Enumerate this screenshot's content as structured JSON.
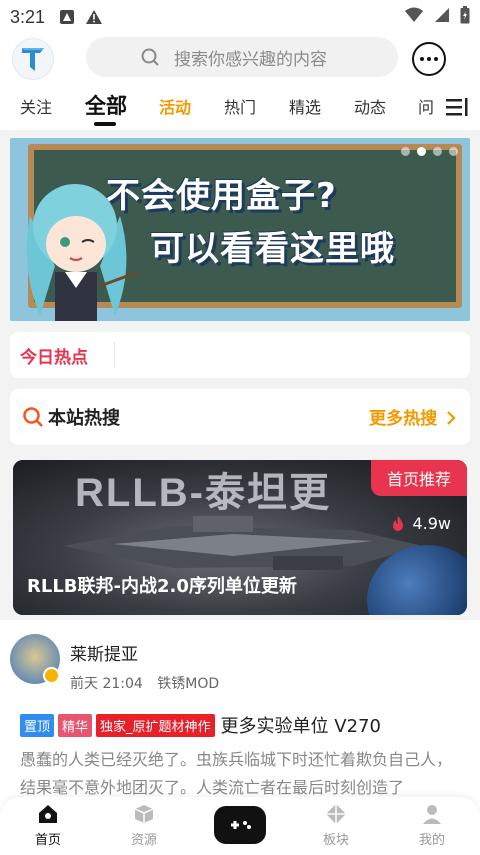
{
  "status_bar": {
    "time": "3:21"
  },
  "header": {
    "logo_icon": "app-logo",
    "search_placeholder": "搜索你感兴趣的内容",
    "message_icon": "chat-bubble-icon"
  },
  "tabs": [
    {
      "label": "关注"
    },
    {
      "label": "全部",
      "active": true
    },
    {
      "label": "活动",
      "highlight": true
    },
    {
      "label": "热门"
    },
    {
      "label": "精选"
    },
    {
      "label": "动态"
    },
    {
      "label": "问"
    }
  ],
  "banner": {
    "line1": "不会使用盒子?",
    "line2": "可以看看这里哦",
    "page_count": 4,
    "current_page": 2
  },
  "today_hot": {
    "title": "今日热点"
  },
  "site_hot": {
    "title": "本站热搜",
    "more": "更多热搜"
  },
  "featured": {
    "bg_text": "RLLB-泰坦更",
    "badge": "首页推荐",
    "heat": "4.9w",
    "title": "RLLB联邦-内战2.0序列单位更新"
  },
  "post": {
    "author": "莱斯提亚",
    "time": "前天 21:04",
    "category": "铁锈MOD",
    "tags": [
      "置顶",
      "精华",
      "独家_原扩题材神作"
    ],
    "title": "更多实验单位 V270",
    "body": "愚蠢的人类已经灭绝了。虫族兵临城下时还忙着欺负自己人，结果毫不意外地团灭了。人类流亡者在最后时刻创造了"
  },
  "bottom_nav": {
    "items": [
      {
        "label": "首页",
        "icon": "home-icon",
        "active": true
      },
      {
        "label": "资源",
        "icon": "box-icon"
      },
      {
        "label": "",
        "icon": "gamepad-icon"
      },
      {
        "label": "板块",
        "icon": "diamond-icon"
      },
      {
        "label": "我的",
        "icon": "profile-icon"
      }
    ]
  },
  "colors": {
    "accent_orange": "#f29a00",
    "accent_red": "#e8344e",
    "tag_blue": "#2f8cf0"
  }
}
